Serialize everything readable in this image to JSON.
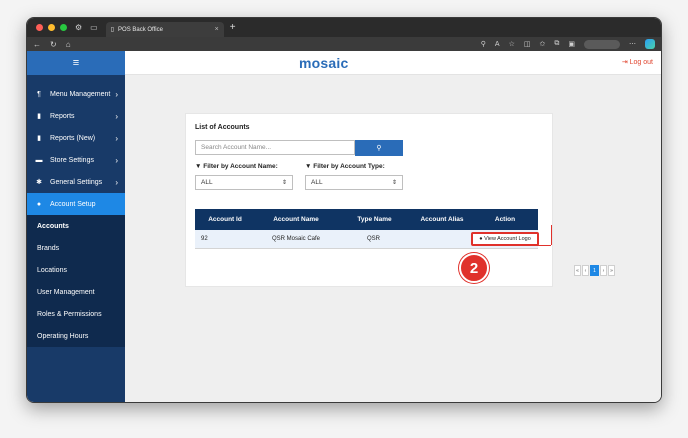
{
  "browser": {
    "tab_title": "POS Back Office",
    "close_glyph": "×",
    "new_tab_glyph": "+"
  },
  "app": {
    "logo": "mosaic",
    "logout": "Log out",
    "menu_glyph": "≡"
  },
  "sidebar": {
    "items": [
      {
        "label": "Menu Management",
        "icon": "utensils-icon"
      },
      {
        "label": "Reports",
        "icon": "file-icon"
      },
      {
        "label": "Reports (New)",
        "icon": "file-icon"
      },
      {
        "label": "Store Settings",
        "icon": "store-icon"
      },
      {
        "label": "General Settings",
        "icon": "gear-icon"
      },
      {
        "label": "Account Setup",
        "icon": "user-icon"
      }
    ],
    "submenu": [
      "Accounts",
      "Brands",
      "Locations",
      "User Management",
      "Roles & Permissions",
      "Operating Hours"
    ]
  },
  "card": {
    "title": "List of Accounts",
    "search_placeholder": "Search Account Name...",
    "filter_name_label": "Filter by Account Name:",
    "filter_type_label": "Filter by Account Type:",
    "filter_name_value": "ALL",
    "filter_type_value": "ALL"
  },
  "table": {
    "headers": [
      "Account Id",
      "Account Name",
      "Type Name",
      "Account Alias",
      "Action"
    ],
    "rows": [
      {
        "id": "92",
        "name": "QSR Mosaic Cafe",
        "type": "QSR",
        "alias": "",
        "action": "View Account Logo"
      }
    ]
  },
  "pagination": {
    "first": "«",
    "prev": "‹",
    "current": "1",
    "next": "›",
    "last": "»"
  },
  "annotation": {
    "step": "2"
  },
  "colors": {
    "accent": "#2a6cb8",
    "sidebar": "#183a68",
    "highlight": "#e0312b"
  }
}
